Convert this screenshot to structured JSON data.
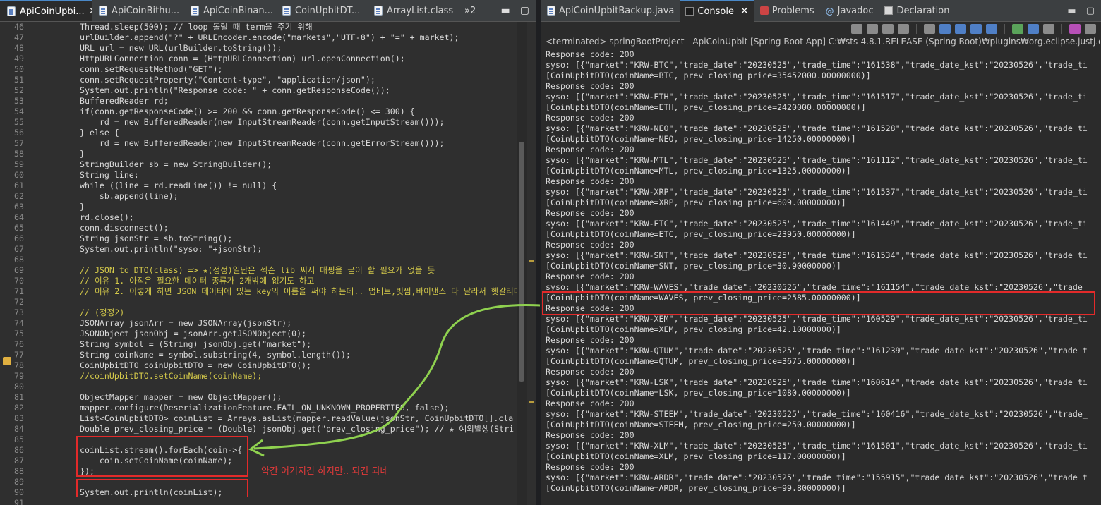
{
  "editor": {
    "tabs": [
      {
        "label": "ApiCoinUpbi...",
        "active": true
      },
      {
        "label": "ApiCoinBithu...",
        "active": false
      },
      {
        "label": "ApiCoinBinan...",
        "active": false
      },
      {
        "label": "CoinUpbitDT...",
        "active": false
      },
      {
        "label": "ArrayList.class",
        "active": false
      }
    ],
    "overflow_label": "»2",
    "lines": [
      {
        "n": "46",
        "code": "Thread.sleep(500); // loop 돌릴 때 term을 주기 위해"
      },
      {
        "n": "47",
        "code": "urlBuilder.append(\"?\" + URLEncoder.encode(\"markets\",\"UTF-8\") + \"=\" + market);"
      },
      {
        "n": "48",
        "code": "URL url = new URL(urlBuilder.toString());"
      },
      {
        "n": "49",
        "code": "HttpURLConnection conn = (HttpURLConnection) url.openConnection();"
      },
      {
        "n": "50",
        "code": "conn.setRequestMethod(\"GET\");"
      },
      {
        "n": "51",
        "code": "conn.setRequestProperty(\"Content-type\", \"application/json\");"
      },
      {
        "n": "52",
        "code": "System.out.println(\"Response code: \" + conn.getResponseCode());"
      },
      {
        "n": "53",
        "code": "BufferedReader rd;"
      },
      {
        "n": "54",
        "code": "if(conn.getResponseCode() >= 200 && conn.getResponseCode() <= 300) {"
      },
      {
        "n": "55",
        "code": "    rd = new BufferedReader(new InputStreamReader(conn.getInputStream()));"
      },
      {
        "n": "56",
        "code": "} else {"
      },
      {
        "n": "57",
        "code": "    rd = new BufferedReader(new InputStreamReader(conn.getErrorStream()));"
      },
      {
        "n": "58",
        "code": "}"
      },
      {
        "n": "59",
        "code": "StringBuilder sb = new StringBuilder();"
      },
      {
        "n": "60",
        "code": "String line;"
      },
      {
        "n": "61",
        "code": "while ((line = rd.readLine()) != null) {"
      },
      {
        "n": "62",
        "code": "    sb.append(line);"
      },
      {
        "n": "63",
        "code": "}"
      },
      {
        "n": "64",
        "code": "rd.close();"
      },
      {
        "n": "65",
        "code": "conn.disconnect();"
      },
      {
        "n": "66",
        "code": "String jsonStr = sb.toString();"
      },
      {
        "n": "67",
        "code": "System.out.println(\"syso: \"+jsonStr);"
      },
      {
        "n": "68",
        "code": ""
      },
      {
        "n": "69",
        "code": "// JSON to DTO(class) => ★(정정)일단은 젝슨 lib 써서 매핑을 굳이 할 필요가 없을 듯"
      },
      {
        "n": "70",
        "code": "// 이유 1. 아직은 필요한 데이터 종류가 2개밖에 없기도 하고"
      },
      {
        "n": "71",
        "code": "// 이유 2. 이렇게 하면 JSON 데이터에 있는 key의 이름을 써야 하는데.. 업비트,빗썸,바이낸스 다 달라서 헷갈리더라고"
      },
      {
        "n": "72",
        "code": ""
      },
      {
        "n": "73",
        "code": "// (정정2)"
      },
      {
        "n": "74",
        "code": "JSONArray jsonArr = new JSONArray(jsonStr);"
      },
      {
        "n": "75",
        "code": "JSONObject jsonObj = jsonArr.getJSONObject(0);"
      },
      {
        "n": "76",
        "code": "String symbol = (String) jsonObj.get(\"market\");"
      },
      {
        "n": "77",
        "code": "String coinName = symbol.substring(4, symbol.length());"
      },
      {
        "n": "78",
        "code": "CoinUpbitDTO coinUpbitDTO = new CoinUpbitDTO();"
      },
      {
        "n": "79",
        "code": "//coinUpbitDTO.setCoinName(coinName);"
      },
      {
        "n": "80",
        "code": ""
      },
      {
        "n": "81",
        "code": "ObjectMapper mapper = new ObjectMapper();"
      },
      {
        "n": "82",
        "code": "mapper.configure(DeserializationFeature.FAIL_ON_UNKNOWN_PROPERTIES, false);"
      },
      {
        "n": "83",
        "code": "List<CoinUpbitDTO> coinList = Arrays.asList(mapper.readValue(jsonStr, CoinUpbitDTO[].cla"
      },
      {
        "n": "84",
        "code": "Double prev_closing_price = (Double) jsonObj.get(\"prev_closing_price\"); // ★ 예외발생(Stri"
      },
      {
        "n": "85",
        "code": ""
      },
      {
        "n": "86",
        "code": "coinList.stream().forEach(coin->{"
      },
      {
        "n": "87",
        "code": "    coin.setCoinName(coinName);"
      },
      {
        "n": "88",
        "code": "});"
      },
      {
        "n": "89",
        "code": ""
      },
      {
        "n": "90",
        "code": "System.out.println(coinList);"
      },
      {
        "n": "91",
        "code": ""
      }
    ],
    "annotation": "약간 어거지긴 하지만.. 되긴 되네"
  },
  "console": {
    "tabs": [
      {
        "label": "ApiCoinUpbitBackup.java",
        "icon": "java-file-icon"
      },
      {
        "label": "Console",
        "icon": "console-icon",
        "active": true
      },
      {
        "label": "Problems",
        "icon": "problems-icon"
      },
      {
        "label": "Javadoc",
        "icon": "javadoc-icon"
      },
      {
        "label": "Declaration",
        "icon": "declaration-icon"
      }
    ],
    "terminated": "<terminated> springBootProject - ApiCoinUpbit [Spring Boot App] C:₩sts-4.8.1.RELEASE (Spring Boot)₩plugins₩org.eclipse.justj.openjdk.hotspot.j",
    "lines": [
      "Response code: 200",
      "syso: [{\"market\":\"KRW-BTC\",\"trade_date\":\"20230525\",\"trade_time\":\"161538\",\"trade_date_kst\":\"20230526\",\"trade_ti",
      "[CoinUpbitDTO(coinName=BTC, prev_closing_price=35452000.00000000)]",
      "Response code: 200",
      "syso: [{\"market\":\"KRW-ETH\",\"trade_date\":\"20230525\",\"trade_time\":\"161517\",\"trade_date_kst\":\"20230526\",\"trade_ti",
      "[CoinUpbitDTO(coinName=ETH, prev_closing_price=2420000.00000000)]",
      "Response code: 200",
      "syso: [{\"market\":\"KRW-NEO\",\"trade_date\":\"20230525\",\"trade_time\":\"161528\",\"trade_date_kst\":\"20230526\",\"trade_ti",
      "[CoinUpbitDTO(coinName=NEO, prev_closing_price=14250.00000000)]",
      "Response code: 200",
      "syso: [{\"market\":\"KRW-MTL\",\"trade_date\":\"20230525\",\"trade_time\":\"161112\",\"trade_date_kst\":\"20230526\",\"trade_ti",
      "[CoinUpbitDTO(coinName=MTL, prev_closing_price=1325.00000000)]",
      "Response code: 200",
      "syso: [{\"market\":\"KRW-XRP\",\"trade_date\":\"20230525\",\"trade_time\":\"161537\",\"trade_date_kst\":\"20230526\",\"trade_ti",
      "[CoinUpbitDTO(coinName=XRP, prev_closing_price=609.00000000)]",
      "Response code: 200",
      "syso: [{\"market\":\"KRW-ETC\",\"trade_date\":\"20230525\",\"trade_time\":\"161449\",\"trade_date_kst\":\"20230526\",\"trade_ti",
      "[CoinUpbitDTO(coinName=ETC, prev_closing_price=23950.00000000)]",
      "Response code: 200",
      "syso: [{\"market\":\"KRW-SNT\",\"trade_date\":\"20230525\",\"trade_time\":\"161534\",\"trade_date_kst\":\"20230526\",\"trade_ti",
      "[CoinUpbitDTO(coinName=SNT, prev_closing_price=30.90000000)]",
      "Response code: 200",
      "syso: [{\"market\":\"KRW-WAVES\",\"trade_date\":\"20230525\",\"trade_time\":\"161154\",\"trade_date_kst\":\"20230526\",\"trade_",
      "[CoinUpbitDTO(coinName=WAVES, prev_closing_price=2585.00000000)]",
      "Response code: 200",
      "syso: [{\"market\":\"KRW-XEM\",\"trade_date\":\"20230525\",\"trade_time\":\"160529\",\"trade_date_kst\":\"20230526\",\"trade_ti",
      "[CoinUpbitDTO(coinName=XEM, prev_closing_price=42.10000000)]",
      "Response code: 200",
      "syso: [{\"market\":\"KRW-QTUM\",\"trade_date\":\"20230525\",\"trade_time\":\"161239\",\"trade_date_kst\":\"20230526\",\"trade_t",
      "[CoinUpbitDTO(coinName=QTUM, prev_closing_price=3675.00000000)]",
      "Response code: 200",
      "syso: [{\"market\":\"KRW-LSK\",\"trade_date\":\"20230525\",\"trade_time\":\"160614\",\"trade_date_kst\":\"20230526\",\"trade_ti",
      "[CoinUpbitDTO(coinName=LSK, prev_closing_price=1080.00000000)]",
      "Response code: 200",
      "syso: [{\"market\":\"KRW-STEEM\",\"trade_date\":\"20230525\",\"trade_time\":\"160416\",\"trade_date_kst\":\"20230526\",\"trade_",
      "[CoinUpbitDTO(coinName=STEEM, prev_closing_price=250.00000000)]",
      "Response code: 200",
      "syso: [{\"market\":\"KRW-XLM\",\"trade_date\":\"20230525\",\"trade_time\":\"161501\",\"trade_date_kst\":\"20230526\",\"trade_ti",
      "[CoinUpbitDTO(coinName=XLM, prev_closing_price=117.00000000)]",
      "Response code: 200",
      "syso: [{\"market\":\"KRW-ARDR\",\"trade_date\":\"20230525\",\"trade_time\":\"155915\",\"trade_date_kst\":\"20230526\",\"trade_t",
      "[CoinUpbitDTO(coinName=ARDR, prev_closing_price=99.80000000)]"
    ]
  },
  "colors": {
    "highlight_red": "#e32a2a",
    "arrow_green": "#8fd14f",
    "annotation_red": "#e33a3a"
  }
}
